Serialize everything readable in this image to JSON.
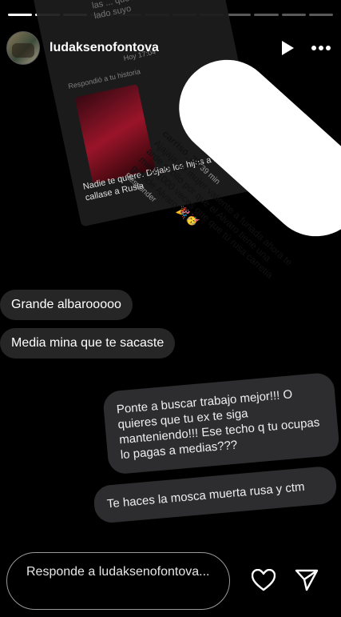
{
  "header": {
    "username": "ludaksenofontova",
    "progress_segments": 12,
    "progress_done": 3
  },
  "background_card": {
    "text": "Andate pa rusia no los quieren las ... que Alvaro tiene ... al lado suyo",
    "time": "Hoy 17:04",
    "replied": "Respondió a tu historia",
    "body": "Nadie te quiere. Déjale los hijos a balero y callase a Rusia"
  },
  "comment_card": {
    "user": "carriso_38",
    "time": "39 min",
    "text": "Ajajaja de mujer valiente a funada ahora te arde el ollo por que el Alvaro tiene una mina 1000 veces que que tú rusa carretia grande Alvaro 🎉🥳",
    "reply": "Responder"
  },
  "left_bubbles": [
    "Grande albarooooo",
    "Media mina que te sacaste"
  ],
  "right_bubbles": [
    "Ponte a buscar trabajo mejor!!! O quieres que tu ex te siga manteniendo!!! Ese techo q tu ocupas lo pagas a medias???",
    "Te haces la mosca muerta rusa y ctm"
  ],
  "reply_bar": {
    "placeholder": "Responde a ludaksenofontova..."
  },
  "icons": {
    "play": "play-icon",
    "more": "more-icon",
    "heart": "heart-icon",
    "send": "send-icon"
  }
}
